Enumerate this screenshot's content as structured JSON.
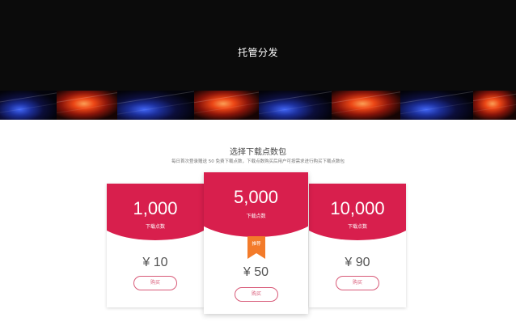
{
  "hero": {
    "title": "托管分发"
  },
  "section": {
    "title": "选择下载点数包",
    "subtitle": "每日首次登录赠送 50 免费下载点数，下载点数购买后用户可按需求进行购买下载点数包"
  },
  "cards": [
    {
      "points": "1,000",
      "unit": "下载点数",
      "price": "¥ 10",
      "button": "购买"
    },
    {
      "points": "5,000",
      "unit": "下载点数",
      "badge": "推荐",
      "price": "¥ 50",
      "button": "购买"
    },
    {
      "points": "10,000",
      "unit": "下载点数",
      "price": "¥ 90",
      "button": "购买"
    }
  ],
  "colors": {
    "accent": "#d81f4d",
    "badge": "#f37b2a",
    "hero_background": "#0b0b0b"
  }
}
